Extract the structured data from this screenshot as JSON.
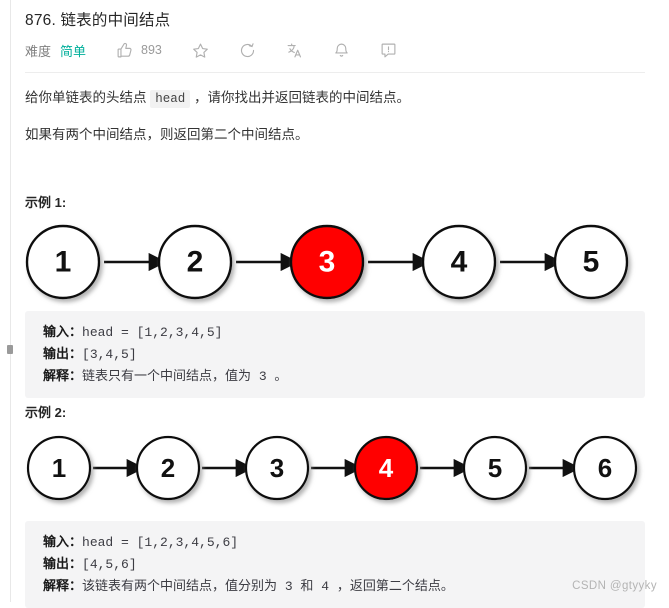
{
  "problem": {
    "title": "876. 链表的中间结点",
    "difficulty_label": "难度",
    "difficulty_value": "简单",
    "like_count": "893"
  },
  "toolbar": {
    "icons": [
      {
        "name": "thumbs-up-icon"
      },
      {
        "name": "star-icon"
      },
      {
        "name": "share-icon"
      },
      {
        "name": "translate-icon"
      },
      {
        "name": "bell-icon"
      },
      {
        "name": "comment-icon"
      }
    ]
  },
  "description": {
    "p1_before": "给你单链表的头结点",
    "p1_code": "head",
    "p1_after": "，请你找出并返回链表的中间结点。",
    "p2": "如果有两个中间结点，则返回第二个中间结点。"
  },
  "examples": [
    {
      "heading": "示例 1:",
      "nodes": [
        "1",
        "2",
        "3",
        "4",
        "5"
      ],
      "highlight_index": 2,
      "input_key": "输入：",
      "input_value": "head = [1,2,3,4,5]",
      "output_key": "输出：",
      "output_value": "[3,4,5]",
      "explain_key": "解释：",
      "explain_value": "链表只有一个中间结点，值为 3 。"
    },
    {
      "heading": "示例 2:",
      "nodes": [
        "1",
        "2",
        "3",
        "4",
        "5",
        "6"
      ],
      "highlight_index": 3,
      "input_key": "输入：",
      "input_value": "head = [1,2,3,4,5,6]",
      "output_key": "输出：",
      "output_value": "[4,5,6]",
      "explain_key": "解释：",
      "explain_value": "该链表有两个中间结点，值分别为 3 和 4 ，返回第二个结点。"
    }
  ],
  "watermark": "CSDN @gtyyky",
  "colors": {
    "highlight": "#ff0000",
    "difficulty": "#00af9b",
    "code_bg": "#f4f4f5"
  }
}
